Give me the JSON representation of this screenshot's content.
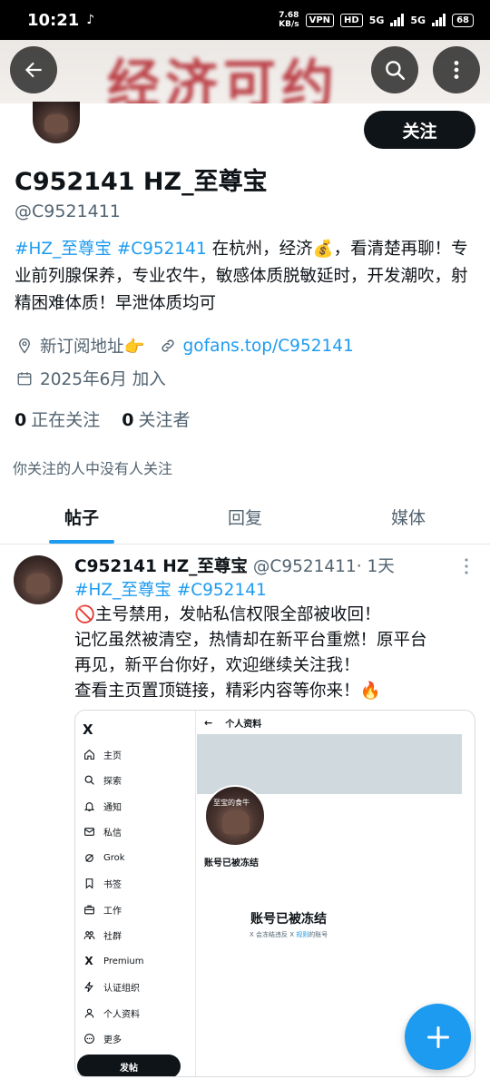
{
  "status_bar": {
    "time": "10:21",
    "speed_value": "7.68",
    "speed_unit": "KB/s",
    "vpn": "VPN",
    "hd": "HD",
    "net1": "5G",
    "net2": "5G",
    "battery": "68"
  },
  "banner": {
    "text": "经济可约"
  },
  "profile": {
    "follow_label": "关注",
    "display_name": "C952141 HZ_至尊宝",
    "handle": "@C9521411",
    "bio_tags": "#HZ_至尊宝 #C952141",
    "bio_text": " 在杭州，经济💰，看清楚再聊！专业前列腺保养，专业农牛，敏感体质脱敏延时，开发潮吹，射精困难体质！早泄体质均可",
    "location": "新订阅地址👉",
    "website": "gofans.top/C952141",
    "joined": "2025年6月 加入",
    "following_count": "0",
    "following_label": "正在关注",
    "followers_count": "0",
    "followers_label": "关注者",
    "mutual_note": "你关注的人中没有人关注"
  },
  "tabs": [
    {
      "label": "帖子"
    },
    {
      "label": "回复"
    },
    {
      "label": "媒体"
    }
  ],
  "post": {
    "name": "C952141 HZ_至尊宝",
    "handle": "@C9521411",
    "time": " · 1天",
    "tags": "#HZ_至尊宝 #C952141",
    "lines": [
      "🚫主号禁用，发帖私信权限全部被收回！",
      "记忆虽然被清空，热情却在新平台重燃！原平台",
      "再见，新平台你好，欢迎继续关注我！",
      "查看主页置顶链接，精彩内容等你来！🔥"
    ]
  },
  "embed": {
    "logo": "X",
    "nav": [
      {
        "label": "主页",
        "icon": "home-icon"
      },
      {
        "label": "探索",
        "icon": "search-icon"
      },
      {
        "label": "通知",
        "icon": "bell-icon"
      },
      {
        "label": "私信",
        "icon": "mail-icon"
      },
      {
        "label": "Grok",
        "icon": "grok-icon"
      },
      {
        "label": "书签",
        "icon": "bookmark-icon"
      },
      {
        "label": "工作",
        "icon": "briefcase-icon"
      },
      {
        "label": "社群",
        "icon": "people-icon"
      },
      {
        "label": "Premium",
        "icon": "x-icon"
      },
      {
        "label": "认证组织",
        "icon": "lightning-icon"
      },
      {
        "label": "个人资料",
        "icon": "person-icon"
      },
      {
        "label": "更多",
        "icon": "more-icon"
      }
    ],
    "post_button": "发帖",
    "page_title": "个人资料",
    "avatar_text": "至宝的食牛",
    "frozen_small": "账号已被冻结",
    "frozen_big": "账号已被冻结",
    "frozen_sub_a": "X 会冻结违反 X ",
    "frozen_sub_link": "规则",
    "frozen_sub_b": "的账号"
  }
}
